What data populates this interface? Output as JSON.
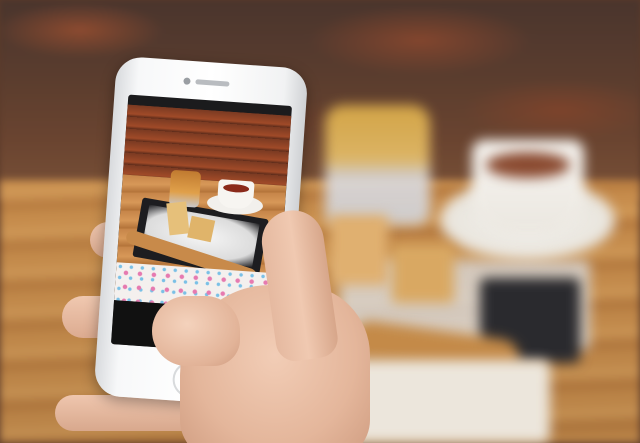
{
  "scene": {
    "palette": {
      "wall": "#5b3d2e",
      "table": "#c58a4a",
      "phone_body": "#ffffff",
      "skin": "#f0c9b1",
      "tea": "#8a4a30"
    },
    "icons": [
      "phone-camera-icon",
      "phone-home-button-icon"
    ]
  }
}
